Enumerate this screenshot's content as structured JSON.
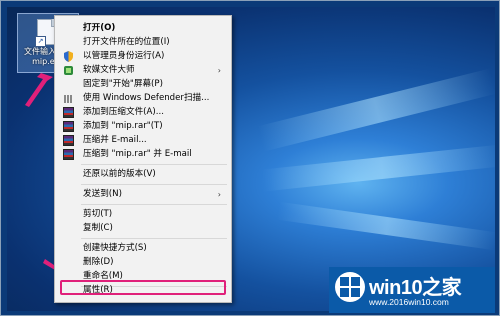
{
  "desktop_icon": {
    "label_line1": "文件输入法助",
    "label_line2": "mip.exe"
  },
  "menu": {
    "items": [
      {
        "label": "打开(O)",
        "bold": true
      },
      {
        "label": "打开文件所在的位置(I)"
      },
      {
        "label": "以管理员身份运行(A)"
      },
      {
        "label": "软媒文件大师",
        "submenu": "›"
      },
      {
        "label": "固定到\"开始\"屏幕(P)"
      },
      {
        "label": "使用 Windows Defender扫描..."
      },
      {
        "label": "添加到压缩文件(A)..."
      },
      {
        "label": "添加到 \"mip.rar\"(T)"
      },
      {
        "label": "压缩并 E-mail..."
      },
      {
        "label": "压缩到 \"mip.rar\" 并 E-mail"
      },
      {
        "label": "还原以前的版本(V)"
      },
      {
        "label": "发送到(N)",
        "submenu": "›"
      },
      {
        "label": "剪切(T)"
      },
      {
        "label": "复制(C)"
      },
      {
        "label": "创建快捷方式(S)"
      },
      {
        "label": "删除(D)"
      },
      {
        "label": "重命名(M)"
      },
      {
        "label": "属性(R)"
      }
    ]
  },
  "highlight_color": "#e0207a",
  "watermark": {
    "brand": "win10之家",
    "url": "www.2016win10.com"
  }
}
